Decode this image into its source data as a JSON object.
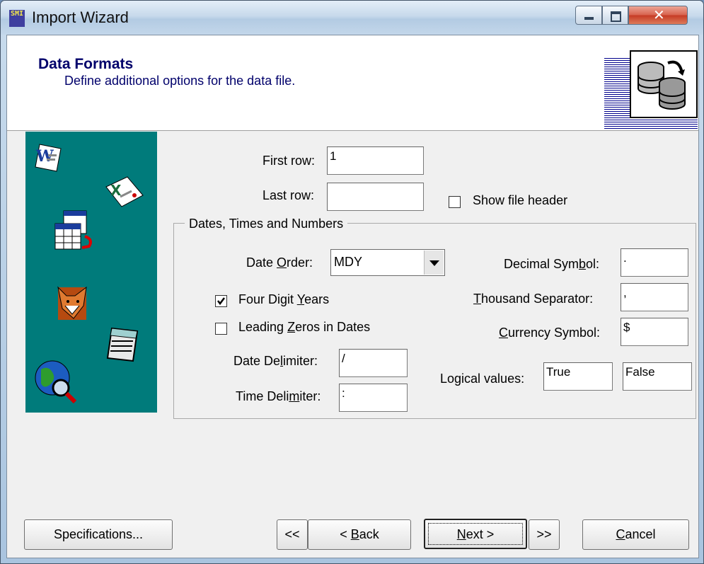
{
  "window": {
    "title": "Import Wizard",
    "app_icon_text": "SMI"
  },
  "header": {
    "title": "Data Formats",
    "subtitle": "Define additional options for the data file."
  },
  "rows": {
    "first_label": "First row:",
    "first_value": "1",
    "last_label": "Last row:",
    "last_value": "",
    "show_header_label": "Show file header",
    "show_header_checked": false
  },
  "group": {
    "title": "Dates, Times and Numbers"
  },
  "date_order": {
    "label_pre": "Date ",
    "label_u": "O",
    "label_post": "rder:",
    "value": "MDY"
  },
  "four_digit": {
    "label_pre": "Four Digit ",
    "label_u": "Y",
    "label_post": "ears",
    "checked": true
  },
  "leading_zeros": {
    "label_pre": "Leading ",
    "label_u": "Z",
    "label_post": "eros in Dates",
    "checked": false
  },
  "date_delim": {
    "label_pre": "Date De",
    "label_u": "l",
    "label_post": "imiter:",
    "value": "/"
  },
  "time_delim": {
    "label_pre": "Time Deli",
    "label_u": "m",
    "label_post": "iter:",
    "value": ":"
  },
  "decimal": {
    "label_pre": "Decimal Sym",
    "label_u": "b",
    "label_post": "ol:",
    "value": "."
  },
  "thousand": {
    "label_pre": "",
    "label_u": "T",
    "label_post": "housand Separator:",
    "value": ","
  },
  "currency": {
    "label_pre": "",
    "label_u": "C",
    "label_post": "urrency Symbol:",
    "value": "$"
  },
  "logical": {
    "label": "Logical values:",
    "true_value": "True",
    "false_value": "False"
  },
  "buttons": {
    "specs": "Specifications...",
    "first": "<<",
    "back_pre": "< ",
    "back_u": "B",
    "back_post": "ack",
    "next_u": "N",
    "next_post": "ext >",
    "last": ">>",
    "cancel_u": "C",
    "cancel_post": "ancel"
  },
  "colors": {
    "sidebar": "#007b7b",
    "header_text": "#00006b"
  },
  "sidebar_icons": [
    "word-document-icon",
    "excel-document-icon",
    "table-import-icon",
    "foxpro-icon",
    "notepad-icon",
    "web-globe-icon"
  ]
}
